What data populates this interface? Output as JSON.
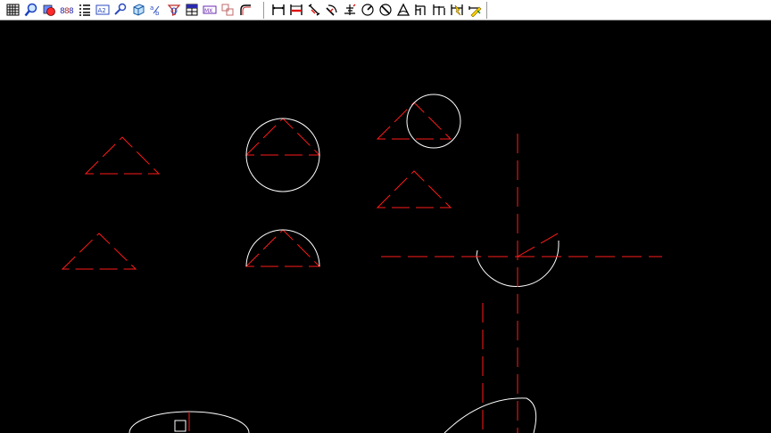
{
  "toolbar": {
    "group1": [
      {
        "name": "grid-icon"
      },
      {
        "name": "zoom-icon"
      },
      {
        "name": "layer-color-icon"
      },
      {
        "name": "counter-icon"
      },
      {
        "name": "list-icon"
      },
      {
        "name": "text-style-icon"
      },
      {
        "name": "find-icon"
      },
      {
        "name": "3d-box-icon"
      },
      {
        "name": "attribute-icon"
      },
      {
        "name": "filter-icon"
      },
      {
        "name": "table-icon"
      },
      {
        "name": "block-icon"
      },
      {
        "name": "group-icon"
      },
      {
        "name": "fillet-icon"
      }
    ],
    "group2": [
      {
        "name": "dim-linear-icon"
      },
      {
        "name": "dim-aligned-red-icon"
      },
      {
        "name": "dim-angled-icon"
      },
      {
        "name": "dim-arc-length-icon"
      },
      {
        "name": "dim-ordinate-icon"
      },
      {
        "name": "dim-radius-icon"
      },
      {
        "name": "dim-diameter-icon"
      },
      {
        "name": "dim-angular-icon"
      },
      {
        "name": "dim-baseline-icon"
      },
      {
        "name": "dim-continue-icon"
      },
      {
        "name": "dim-quick-icon"
      },
      {
        "name": "dim-edit-icon"
      }
    ]
  },
  "drawing": {
    "colors": {
      "background": "#000000",
      "dashed_lines": "#ff1a1a",
      "solid_lines": "#ffffff",
      "toolbar": "#ffffff"
    }
  }
}
